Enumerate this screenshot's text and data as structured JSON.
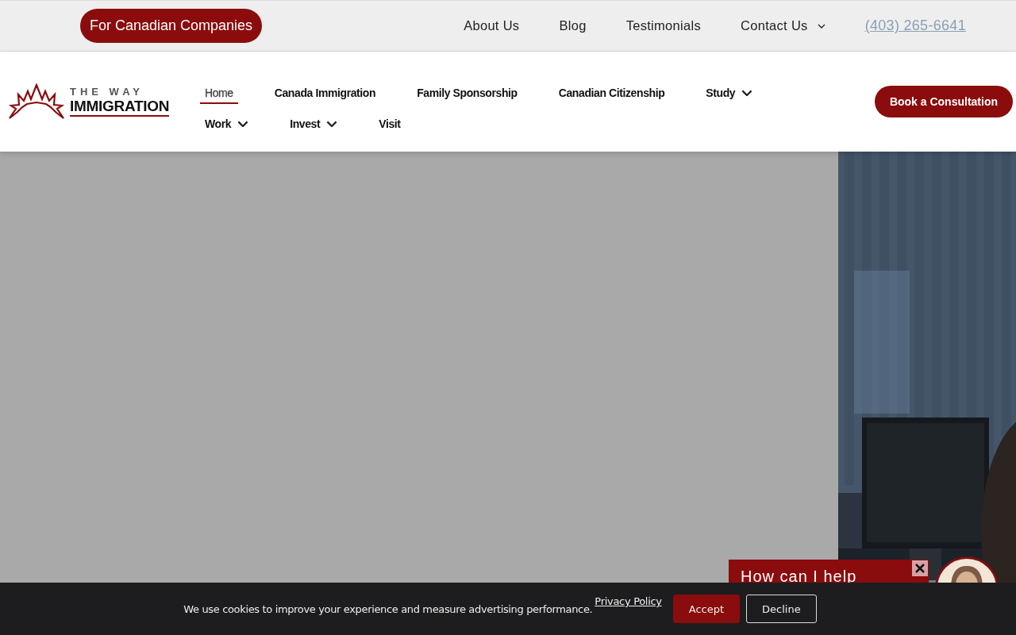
{
  "top_bar": {
    "companies_button": "For Canadian Companies",
    "links": [
      {
        "label": "About Us",
        "dropdown": false
      },
      {
        "label": "Blog",
        "dropdown": false
      },
      {
        "label": "Testimonials",
        "dropdown": false
      },
      {
        "label": "Contact Us",
        "dropdown": true
      }
    ],
    "phone": "(403) 265-6641"
  },
  "header": {
    "logo": {
      "line1": "THE WAY",
      "line2": "IMMIGRATION"
    },
    "nav": [
      {
        "label": "Home",
        "selected": true,
        "dropdown": false
      },
      {
        "label": "Canada Immigration",
        "selected": false,
        "dropdown": false
      },
      {
        "label": "Family Sponsorship",
        "selected": false,
        "dropdown": false
      },
      {
        "label": "Canadian Citizenship",
        "selected": false,
        "dropdown": false
      },
      {
        "label": "Study",
        "selected": false,
        "dropdown": true
      },
      {
        "label": "Work",
        "selected": false,
        "dropdown": true
      },
      {
        "label": "Invest",
        "selected": false,
        "dropdown": true
      },
      {
        "label": "Visit",
        "selected": false,
        "dropdown": false
      }
    ],
    "cta": "Book a Consultation"
  },
  "chat": {
    "greeting": "How can I help"
  },
  "cookie_banner": {
    "message": "We use cookies to improve your experience and measure advertising performance.",
    "privacy_link": "Privacy Policy",
    "buttons": [
      {
        "label": "Accept",
        "kind": "primary"
      },
      {
        "label": "Decline",
        "kind": "outline"
      }
    ]
  }
}
